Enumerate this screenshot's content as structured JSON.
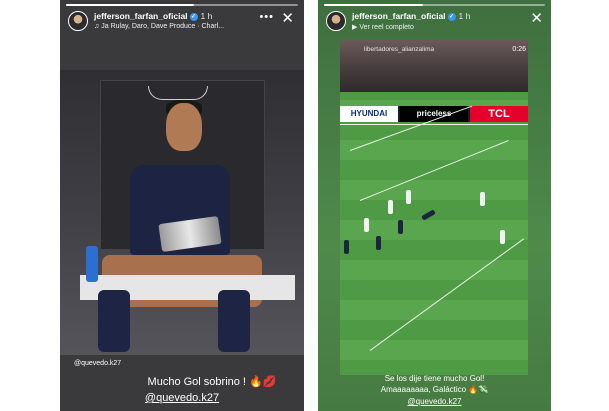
{
  "left_story": {
    "username": "jefferson_farfan_oficial",
    "time": "1 h",
    "music": "Ja Rulay, Daro, Dave Produce · Charl...",
    "mention_small": "@quevedo.k27",
    "caption": "Mucho Gol sobrino !",
    "caption_emoji": "🔥💋",
    "mention": "@quevedo.k27",
    "progress_fraction": 0.55
  },
  "right_story": {
    "username": "jefferson_farfan_oficial",
    "time": "1 h",
    "reel_link": "Ver reel completo",
    "video_overlay": "libertadores_alianzalima",
    "video_time": "0:26",
    "boards": [
      "HYUNDAI",
      "priceless",
      "TCL"
    ],
    "caption_line1": "Se los dije tiene mucho Gol!",
    "caption_line2": "Amaaaaaaaa, Galáctico 🔥💸",
    "mention": "@quevedo.k27",
    "progress_fraction": 0.45
  },
  "icons": {
    "more": "more-options-icon",
    "close": "close-icon",
    "verified": "verified-badge-icon",
    "music": "music-note-icon",
    "reel": "reel-icon"
  }
}
